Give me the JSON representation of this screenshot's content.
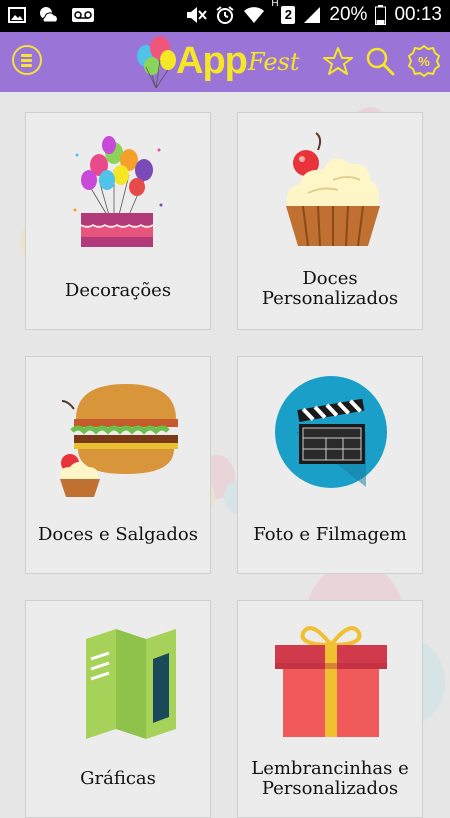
{
  "status_bar": {
    "battery_percent": "20%",
    "time": "00:13",
    "sim_slot": "2",
    "network_type": "H",
    "icons": [
      "gallery-icon",
      "weather-icon",
      "voicemail-icon",
      "mute-icon",
      "alarm-icon",
      "wifi-icon",
      "signal-icon",
      "battery-icon"
    ]
  },
  "app_bar": {
    "logo_app": "App",
    "logo_fest": "Fest",
    "background_color": "#9b74d8",
    "accent_color": "#f5e626",
    "icons": [
      "menu-icon",
      "star-icon",
      "search-icon",
      "discount-icon"
    ]
  },
  "categories": [
    {
      "label": "Decorações",
      "icon": "balloon-cake-icon"
    },
    {
      "label": "Doces Personalizados",
      "icon": "cupcake-icon"
    },
    {
      "label": "Doces e Salgados",
      "icon": "burger-cupcake-icon"
    },
    {
      "label": "Foto e Filmagem",
      "icon": "clapperboard-icon"
    },
    {
      "label": "Gráficas",
      "icon": "brochure-icon"
    },
    {
      "label": "Lembrancinhas e Personalizados",
      "icon": "gift-box-icon"
    }
  ]
}
